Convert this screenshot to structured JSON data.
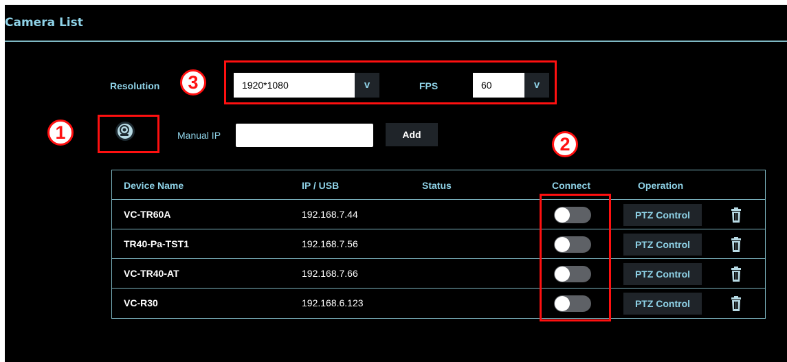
{
  "page": {
    "title": "Camera List"
  },
  "settings": {
    "resolution_label": "Resolution",
    "resolution_value": "1920*1080",
    "fps_label": "FPS",
    "fps_value": "60"
  },
  "manual": {
    "label": "Manual IP",
    "ip_value": "",
    "add_label": "Add"
  },
  "annotations": {
    "marker1": "1",
    "marker2": "2",
    "marker3": "3"
  },
  "table": {
    "headers": {
      "device_name": "Device Name",
      "ip": "IP / USB",
      "status": "Status",
      "connect": "Connect",
      "operation": "Operation"
    },
    "rows": [
      {
        "name": "VC-TR60A",
        "ip": "192.168.7.44",
        "status": "",
        "connected": false,
        "op": "PTZ Control"
      },
      {
        "name": "TR40-Pa-TST1",
        "ip": "192.168.7.56",
        "status": "",
        "connected": false,
        "op": "PTZ Control"
      },
      {
        "name": "VC-TR40-AT",
        "ip": "192.168.7.66",
        "status": "",
        "connected": false,
        "op": "PTZ Control"
      },
      {
        "name": "VC-R30",
        "ip": "192.168.6.123",
        "status": "",
        "connected": false,
        "op": "PTZ Control"
      }
    ]
  },
  "icons": {
    "scan": "camera-search-icon",
    "dropdown": "chevron-down-icon",
    "delete": "trash-icon"
  },
  "colors": {
    "accent": "#8fd3e8",
    "annotation": "#ff1010",
    "background": "#000000",
    "button": "#1f2429"
  }
}
